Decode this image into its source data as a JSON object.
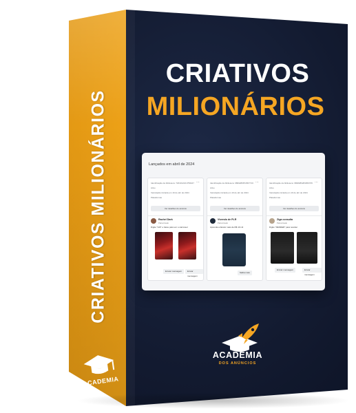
{
  "product": {
    "title_line1": "CRIATIVOS",
    "title_line2": "MILIONÁRIOS",
    "spine_title": "CRIATIVOS MILIONÁRIOS",
    "brand_spine": "ACADEMIA",
    "brand_front": "ACADEMIA",
    "brand_front_sub": "DOS ANÚNCIOS"
  },
  "screenshot": {
    "heading": "Lançados em abril de 2024",
    "columns": [
      {
        "id_line": "Identificação da biblioteca: 7184312161758247",
        "status": "Ativo",
        "started": "Veiculação iniciada em 19 de abr de 2024",
        "platforms": "Plataformas",
        "details_button": "Ver detalhes do anúncio",
        "page_name": "Rachel Dark",
        "page_sub": "Patrocinado",
        "caption": "Digite \"GIF\" e baixe para ver o carrossel",
        "cta": "Enviar mensagem"
      },
      {
        "id_line": "Identificação da biblioteca: 9899286872657716",
        "status": "Ativo",
        "started": "Veiculação iniciada em 19 de abr de 2024",
        "platforms": "Plataformas",
        "details_button": "Ver detalhes do anúncio",
        "page_name": "Vivendo de PLR",
        "page_sub": "Patrocinado",
        "caption": "Aprenda a faturar mais de R$ 10 mil",
        "cta": "Saiba mais"
      },
      {
        "id_line": "Identificação da biblioteca: 9838286283059735",
        "status": "Ativo",
        "started": "Veiculação iniciada em 19 de abr de 2024",
        "platforms": "Plataformas",
        "details_button": "Ver detalhes do anúncio",
        "page_name": "Ziga consulta",
        "page_sub": "Patrocinado",
        "caption": "Digite \"RENDER\" para receber",
        "cta": "Enviar mensagem"
      }
    ]
  },
  "colors": {
    "spine": "#f2a619",
    "front": "#131b31",
    "accent": "#f5a623",
    "title": "#ffffff"
  }
}
